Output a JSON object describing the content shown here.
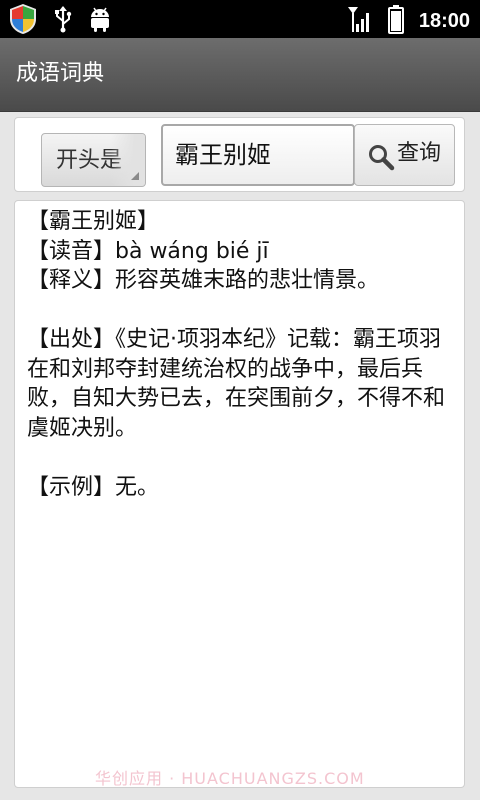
{
  "status_bar": {
    "time": "18:00",
    "icons": [
      "shield-icon",
      "usb-icon",
      "android-icon",
      "signal-icon",
      "battery-icon"
    ]
  },
  "app": {
    "title": "成语词典"
  },
  "search": {
    "mode_label": "开头是",
    "query_value": "霸王别姬",
    "button_label": "查询"
  },
  "result": {
    "title_line": "【霸王别姬】",
    "pronunciation_line": "【读音】bà  wáng  bié  jī",
    "meaning_line": "【释义】形容英雄末路的悲壮情景。",
    "source_text": "【出处】《史记·项羽本纪》记载：霸王项羽在和刘邦夺封建统治权的战争中，最后兵败，自知大势已去，在突围前夕，不得不和虞姬决别。",
    "example_line": "【示例】无。"
  },
  "watermark": "华创应用 · HUACHUANGZS.COM",
  "colors": {
    "status_bar_bg": "#000000",
    "title_bar_bg": "#5a5a5a",
    "app_bg": "#e6e6e6",
    "panel_bg": "#ffffff"
  }
}
